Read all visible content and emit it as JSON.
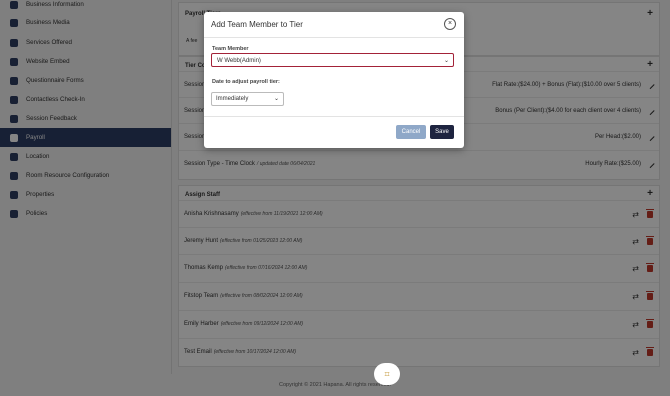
{
  "sidebar": {
    "items": [
      {
        "label": "Business Information",
        "icon": "info-icon"
      },
      {
        "label": "Business Media",
        "icon": "media-icon"
      },
      {
        "label": "Services Offered",
        "icon": "services-icon"
      },
      {
        "label": "Website Embed",
        "icon": "globe-icon"
      },
      {
        "label": "Questionnaire Forms",
        "icon": "form-icon"
      },
      {
        "label": "Contactless Check-In",
        "icon": "checkin-icon"
      },
      {
        "label": "Session Feedback",
        "icon": "feedback-icon"
      },
      {
        "label": "Payroll",
        "icon": "dollar-icon"
      },
      {
        "label": "Location",
        "icon": "location-icon"
      },
      {
        "label": "Room Resource Configuration",
        "icon": "room-icon"
      },
      {
        "label": "Properties",
        "icon": "properties-icon"
      },
      {
        "label": "Policies",
        "icon": "policies-icon"
      }
    ]
  },
  "payroll": {
    "tier_heading": "Payroll Tiers",
    "tier_configuration_heading": "Tier Co",
    "checkbox_fragment": "A fee",
    "sessions": [
      {
        "name": "Session",
        "rate_html": "Flat Rate:($24.00) + Bonus (Flat):($10.00 over 5 clients)"
      },
      {
        "name": "Session",
        "rate_html": "Bonus (Per Client):($4.00 for each client over 4 clients)"
      },
      {
        "name": "Session",
        "rate_html": "Per Head:($2.00)"
      },
      {
        "name": "Session Type - Time Clock",
        "note": "/ updated date 06/04/2021",
        "rate_html": "Hourly Rate:($25.00)"
      }
    ],
    "assign_staff_heading": "Assign Staff",
    "staff": [
      {
        "name": "Anisha Krishnasamy",
        "note": "(effective from 11/19/2021 12:00 AM)"
      },
      {
        "name": "Jeremy Hunt",
        "note": "(effective from 01/25/2023 12:00 AM)"
      },
      {
        "name": "Thomas Kemp",
        "note": "(effective from 07/16/2024 12:00 AM)"
      },
      {
        "name": "Fitstop Team",
        "note": "(effective from 08/02/2024 12:00 AM)"
      },
      {
        "name": "Emily Harber",
        "note": "(effective from 09/12/2024 12:00 AM)"
      },
      {
        "name": "Test Email",
        "note": "(effective from 10/17/2024 12:00 AM)"
      }
    ]
  },
  "modal": {
    "title": "Add Team Member to Tier",
    "close_glyph": "×",
    "team_member_label": "Team Member",
    "team_member_value": "W Webb(Admin)",
    "date_label": "Date to adjust payroll tier:",
    "date_value": "Immediately",
    "cancel_label": "Cancel",
    "save_label": "Save"
  },
  "footer": {
    "text": "Copyright © 2021 Hapana. All rights reserved."
  },
  "colors": {
    "sidebar_active": "#2c3e66",
    "save_button": "#1e2440",
    "cancel_button": "#8fa8c8",
    "select_focus": "#a32238",
    "trash": "#c0392b"
  }
}
